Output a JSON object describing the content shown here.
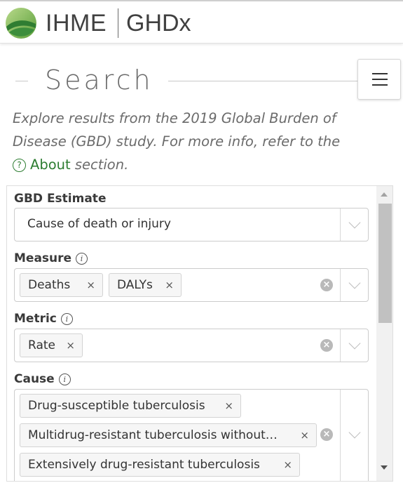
{
  "header": {
    "brand_ihme": "IHME",
    "brand_ghdx": "GHDx",
    "logo_icon": "ihme-leaf-logo"
  },
  "menu": {
    "icon": "hamburger-icon"
  },
  "search": {
    "title": "Search",
    "intro_text": "Explore results from the 2019 Global Burden of Disease (GBD) study. For more info, refer to the",
    "about_link": "About",
    "intro_suffix": "section."
  },
  "form": {
    "gbd_estimate": {
      "label": "GBD Estimate",
      "value": "Cause of death or injury"
    },
    "measure": {
      "label": "Measure",
      "tags": [
        "Deaths",
        "DALYs"
      ]
    },
    "metric": {
      "label": "Metric",
      "tags": [
        "Rate"
      ]
    },
    "cause": {
      "label": "Cause",
      "tags": [
        "Drug-susceptible tuberculosis",
        "Multidrug-resistant tuberculosis without…",
        "Extensively drug-resistant tuberculosis"
      ]
    },
    "tag_remove": "×",
    "clear_icon": "×",
    "info_icon": "i"
  },
  "colors": {
    "accent_green": "#2e7d32",
    "text_gray": "#6b6b6b"
  }
}
